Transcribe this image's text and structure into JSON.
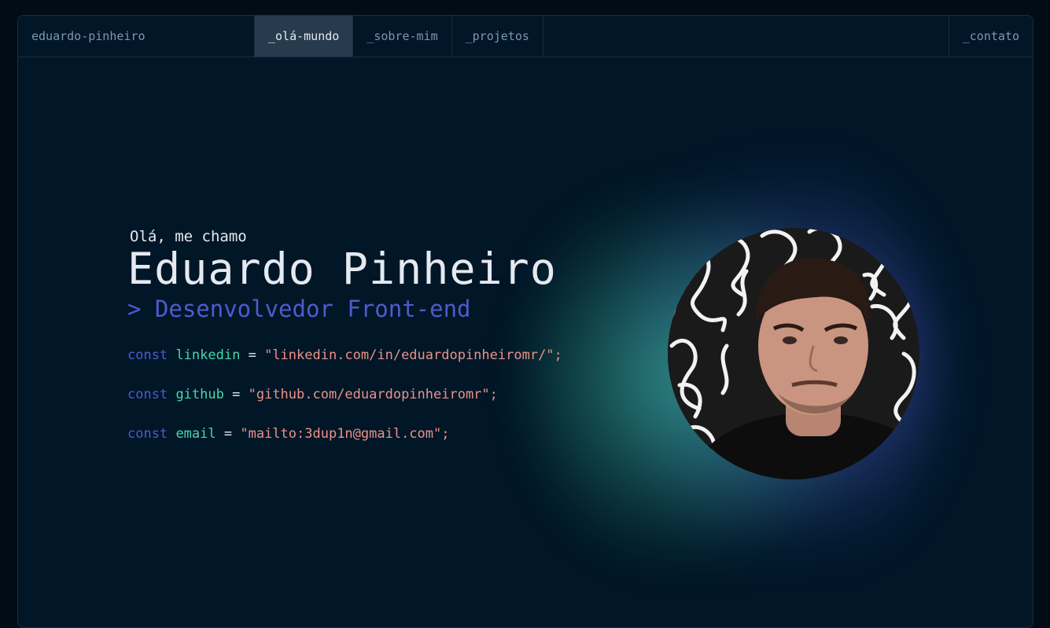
{
  "nav": {
    "brand": "eduardo-pinheiro",
    "items": [
      {
        "label": "_olá-mundo",
        "active": true
      },
      {
        "label": "_sobre-mim",
        "active": false
      },
      {
        "label": "_projetos",
        "active": false
      }
    ],
    "contact": "_contato"
  },
  "hero": {
    "greeting": "Olá, me chamo",
    "name": "Eduardo Pinheiro",
    "role": "> Desenvolvedor Front-end",
    "links": [
      {
        "keyword": "const",
        "name": "linkedin",
        "op": "=",
        "value": "\"linkedin.com/in/eduardopinheiromr/\";"
      },
      {
        "keyword": "const",
        "name": "github",
        "op": "=",
        "value": "\"github.com/eduardopinheiromr\";"
      },
      {
        "keyword": "const",
        "name": "email",
        "op": "=",
        "value": "\"mailto:3dup1n@gmail.com\";"
      }
    ]
  },
  "colors": {
    "background": "#011627",
    "keyword": "#4d5bce",
    "variable": "#43d9ad",
    "string": "#e99287",
    "text": "#e5e9f0",
    "muted": "#7e96b0"
  },
  "icons": {
    "avatar": "profile-photo"
  }
}
